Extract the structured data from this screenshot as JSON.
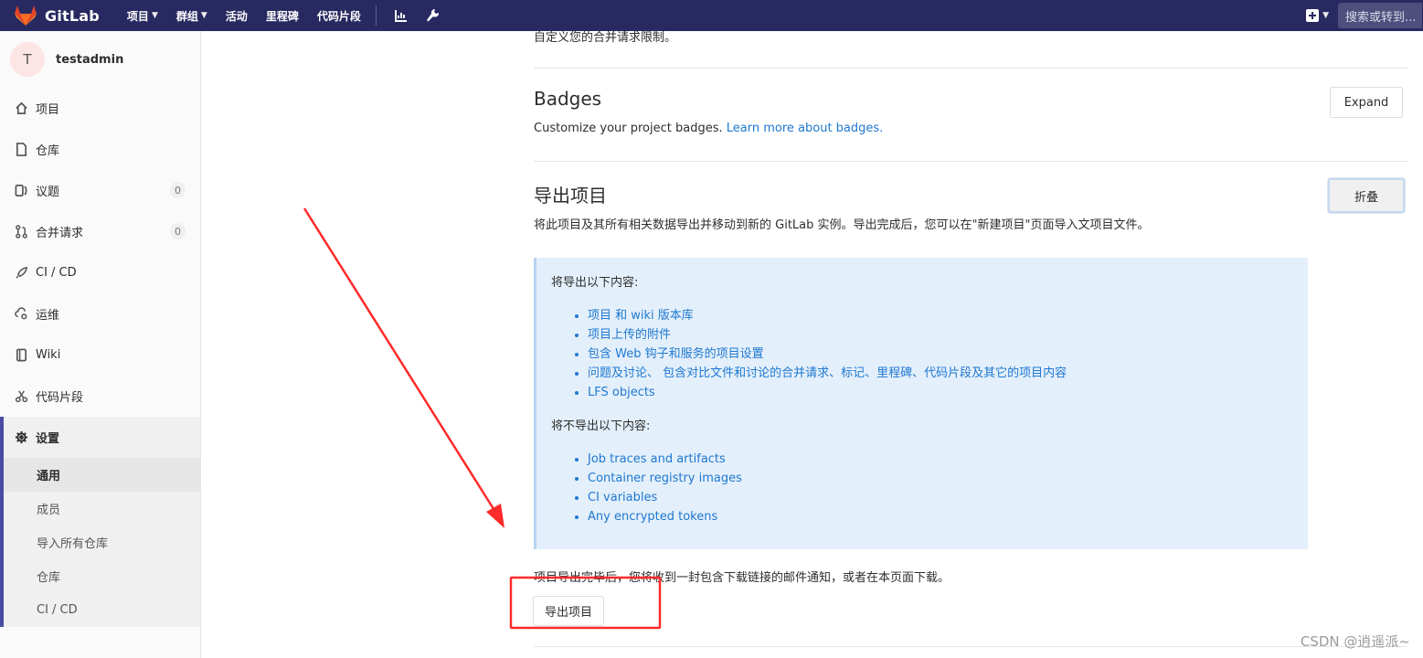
{
  "navbar": {
    "brand": "GitLab",
    "menu": [
      {
        "label": "项目",
        "dropdown": true
      },
      {
        "label": "群组",
        "dropdown": true
      },
      {
        "label": "活动",
        "dropdown": false
      },
      {
        "label": "里程碑",
        "dropdown": false
      },
      {
        "label": "代码片段",
        "dropdown": false
      }
    ],
    "icons": [
      "chart-icon",
      "wrench-icon"
    ],
    "new_icon": "plus-square-icon",
    "search_placeholder": "搜索或转到...",
    "colors": {
      "bar": "#292961"
    }
  },
  "sidebar": {
    "context": {
      "avatar_letter": "T",
      "name": "testadmin"
    },
    "items": [
      {
        "label": "项目",
        "icon": "home-icon"
      },
      {
        "label": "仓库",
        "icon": "doc-icon"
      },
      {
        "label": "议题",
        "icon": "issues-icon",
        "badge": "0"
      },
      {
        "label": "合并请求",
        "icon": "merge-request-icon",
        "badge": "0"
      },
      {
        "label": "CI / CD",
        "icon": "rocket-icon"
      },
      {
        "label": "运维",
        "icon": "cloud-gear-icon"
      },
      {
        "label": "Wiki",
        "icon": "book-icon"
      },
      {
        "label": "代码片段",
        "icon": "scissors-icon"
      }
    ],
    "settings": {
      "label": "设置",
      "icon": "gear-icon",
      "sub_items": [
        {
          "label": "通用",
          "active": true
        },
        {
          "label": "成员",
          "active": false
        },
        {
          "label": "导入所有仓库",
          "active": false
        },
        {
          "label": "仓库",
          "active": false
        },
        {
          "label": "CI / CD",
          "active": false
        }
      ]
    }
  },
  "main": {
    "cut_text": "自定义您的合并请求限制。",
    "badges": {
      "title": "Badges",
      "desc": "Customize your project badges.",
      "link": "Learn more about badges.",
      "button": "Expand"
    },
    "export": {
      "title": "导出项目",
      "desc": "将此项目及其所有相关数据导出并移动到新的 GitLab 实例。导出完成后，您可以在\"新建项目\"页面导入文项目文件。",
      "button": "折叠",
      "box": {
        "included_title": "将导出以下内容:",
        "included": [
          "项目 和 wiki 版本库",
          "项目上传的附件",
          "包含 Web 钩子和服务的项目设置",
          "问题及讨论、 包含对比文件和讨论的合并请求、标记、里程碑、代码片段及其它的项目内容",
          "LFS objects"
        ],
        "excluded_title": "将不导出以下内容:",
        "excluded": [
          "Job traces and artifacts",
          "Container registry images",
          "CI variables",
          "Any encrypted tokens"
        ]
      },
      "note": "项目导出完毕后，您将收到一封包含下载链接的邮件通知，或者在本页面下载。",
      "export_button": "导出项目"
    }
  },
  "annotation": {
    "color": "#ff2a2a"
  },
  "watermark": "CSDN @逍遥派~"
}
